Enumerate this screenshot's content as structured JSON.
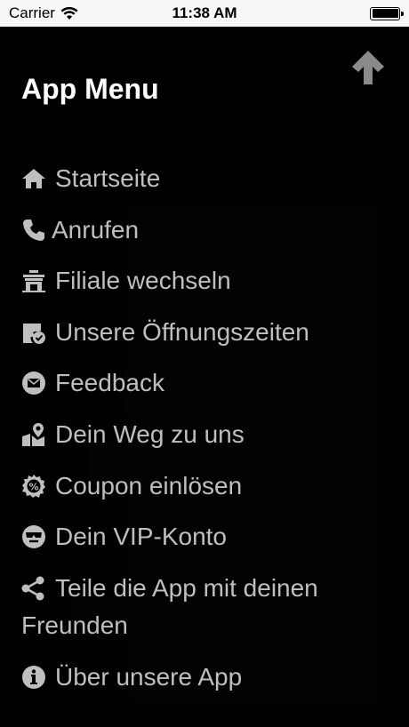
{
  "status_bar": {
    "carrier": "Carrier",
    "time": "11:38 AM"
  },
  "drawer": {
    "title": "App Menu",
    "items": [
      {
        "label": "Startseite",
        "icon": "home-icon"
      },
      {
        "label": "Anrufen",
        "icon": "phone-icon"
      },
      {
        "label": "Filiale wechseln",
        "icon": "store-icon"
      },
      {
        "label": "Unsere Öffnungszeiten",
        "icon": "calendar-check-icon"
      },
      {
        "label": "Feedback",
        "icon": "mail-icon"
      },
      {
        "label": "Dein Weg zu uns",
        "icon": "map-pin-icon"
      },
      {
        "label": "Coupon einlösen",
        "icon": "coupon-icon"
      },
      {
        "label": "Dein VIP-Konto",
        "icon": "vip-icon"
      },
      {
        "label": "Teile die App mit deinen Freunden",
        "icon": "share-icon"
      },
      {
        "label": "Über unsere App",
        "icon": "info-icon"
      }
    ]
  },
  "colors": {
    "overlay": "#000000",
    "menu_text": "#bfbfbf",
    "title_text": "#ffffff"
  }
}
